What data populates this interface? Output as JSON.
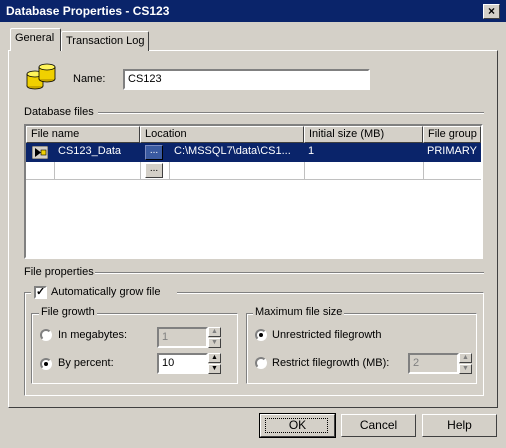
{
  "window": {
    "title": "Database Properties - CS123",
    "close": "×"
  },
  "tabs": [
    "General",
    "Transaction Log"
  ],
  "name": {
    "label": "Name:",
    "value": "CS123"
  },
  "database_files": {
    "section_label": "Database files",
    "columns": [
      "File name",
      "Location",
      "Initial size (MB)",
      "File group"
    ],
    "rows": [
      {
        "file_name": "CS123_Data",
        "location": "C:\\MSSQL7\\data\\CS1...",
        "initial_size": "1",
        "file_group": "PRIMARY"
      }
    ],
    "browse": "..."
  },
  "file_properties": {
    "section_label": "File properties",
    "auto_grow": {
      "label": "Automatically grow file",
      "checked": true
    },
    "file_growth": {
      "title": "File growth",
      "in_megabytes": {
        "label": "In megabytes:",
        "value": "1",
        "selected": false
      },
      "by_percent": {
        "label": "By percent:",
        "value": "10",
        "selected": true
      }
    },
    "max_size": {
      "title": "Maximum file size",
      "unrestricted": {
        "label": "Unrestricted filegrowth",
        "selected": true
      },
      "restrict": {
        "label": "Restrict filegrowth (MB):",
        "value": "2",
        "selected": false
      }
    }
  },
  "buttons": {
    "ok": "OK",
    "cancel": "Cancel",
    "help": "Help"
  }
}
